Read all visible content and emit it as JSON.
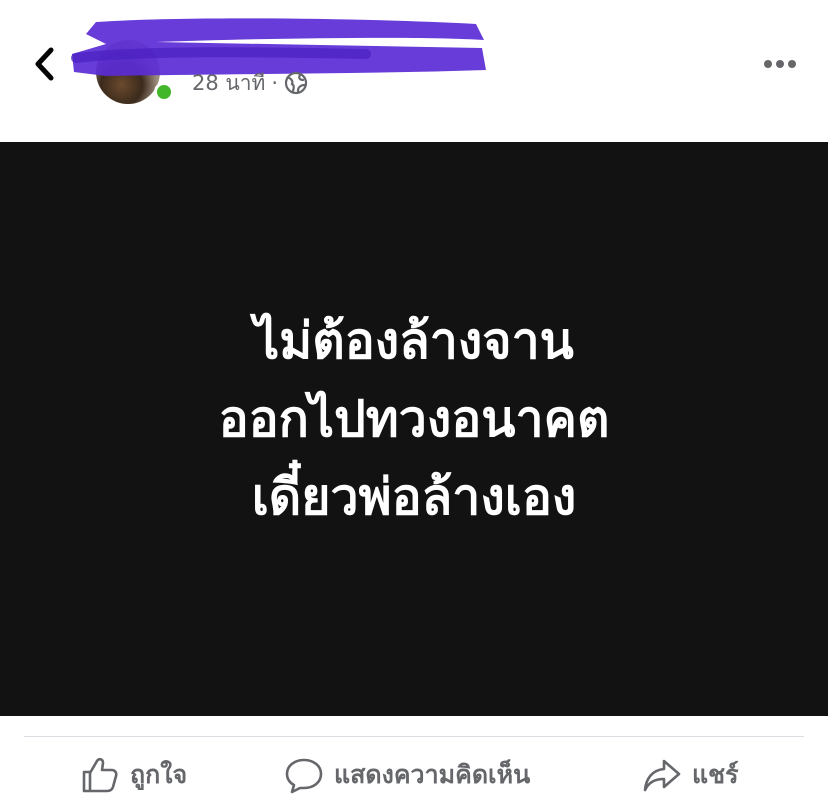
{
  "post": {
    "time": "28 นาที",
    "separator": "·",
    "text_lines": [
      "ไม่ต้องล้างจาน",
      "ออกไปทวงอนาคต",
      "เดี๋ยวพ่อล้างเอง"
    ]
  },
  "actions": {
    "like_label": "ถูกใจ",
    "comment_label": "แสดงความคิดเห็น",
    "share_label": "แชร์"
  },
  "icons": {
    "back": "chevron-left-icon",
    "privacy": "globe-icon",
    "more": "more-horizontal-icon",
    "like": "thumbs-up-icon",
    "comment": "comment-bubble-icon",
    "share": "share-arrow-icon"
  },
  "colors": {
    "post_background": "#121212",
    "post_text": "#ffffff",
    "secondary_text": "#65676b",
    "online": "#42b72a",
    "redaction": "#5b2bd6"
  }
}
